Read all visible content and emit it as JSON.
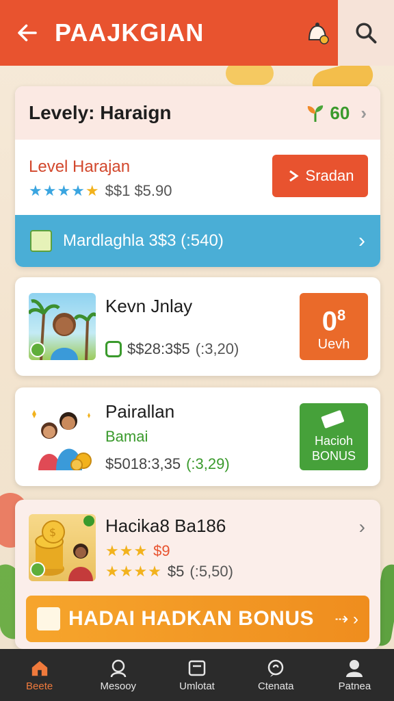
{
  "header": {
    "title": "PAAJKGIAN"
  },
  "summary_card": {
    "title": "Levely: Haraign",
    "badge_value": "60",
    "level_label": "Level Harajan",
    "stars": "★★★★★",
    "price": "$$1 $5.90",
    "action_label": "Sradan",
    "strip_text": "Mardlaghla 3$3 (:540)"
  },
  "items": [
    {
      "name": "Kevn Jnlay",
      "price": "$$28:3$5",
      "detail": "(:3,20)",
      "tile_big": "0",
      "tile_sup": "8",
      "tile_label": "Uevh"
    },
    {
      "name": "Pairallan",
      "subtitle": "Bamai",
      "price": "$5018:3,35",
      "detail": "(:3,29)",
      "tile_label": "Hacioh BONUS"
    },
    {
      "name": "Hacika8 Ba186",
      "stars_top": "★★★",
      "price_top": "$9",
      "stars_bottom": "★★★★",
      "price": "$5",
      "detail": "(:5,50)"
    }
  ],
  "bonus_bar": {
    "label": "HADAI HADKAN BONUS",
    "arrow": "⇢ ›"
  },
  "nav": [
    {
      "label": "Beete",
      "icon": "home-icon",
      "active": true
    },
    {
      "label": "Mesooy",
      "icon": "profile-icon"
    },
    {
      "label": "Umlotat",
      "icon": "wallet-icon"
    },
    {
      "label": "Ctenata",
      "icon": "chat-icon"
    },
    {
      "label": "Patnea",
      "icon": "user-icon"
    }
  ],
  "colors": {
    "primary": "#e8532f",
    "accent_blue": "#4aaed6",
    "green": "#46a13a",
    "orange": "#ef8d1e",
    "nav_bg": "#2b2b2b"
  }
}
